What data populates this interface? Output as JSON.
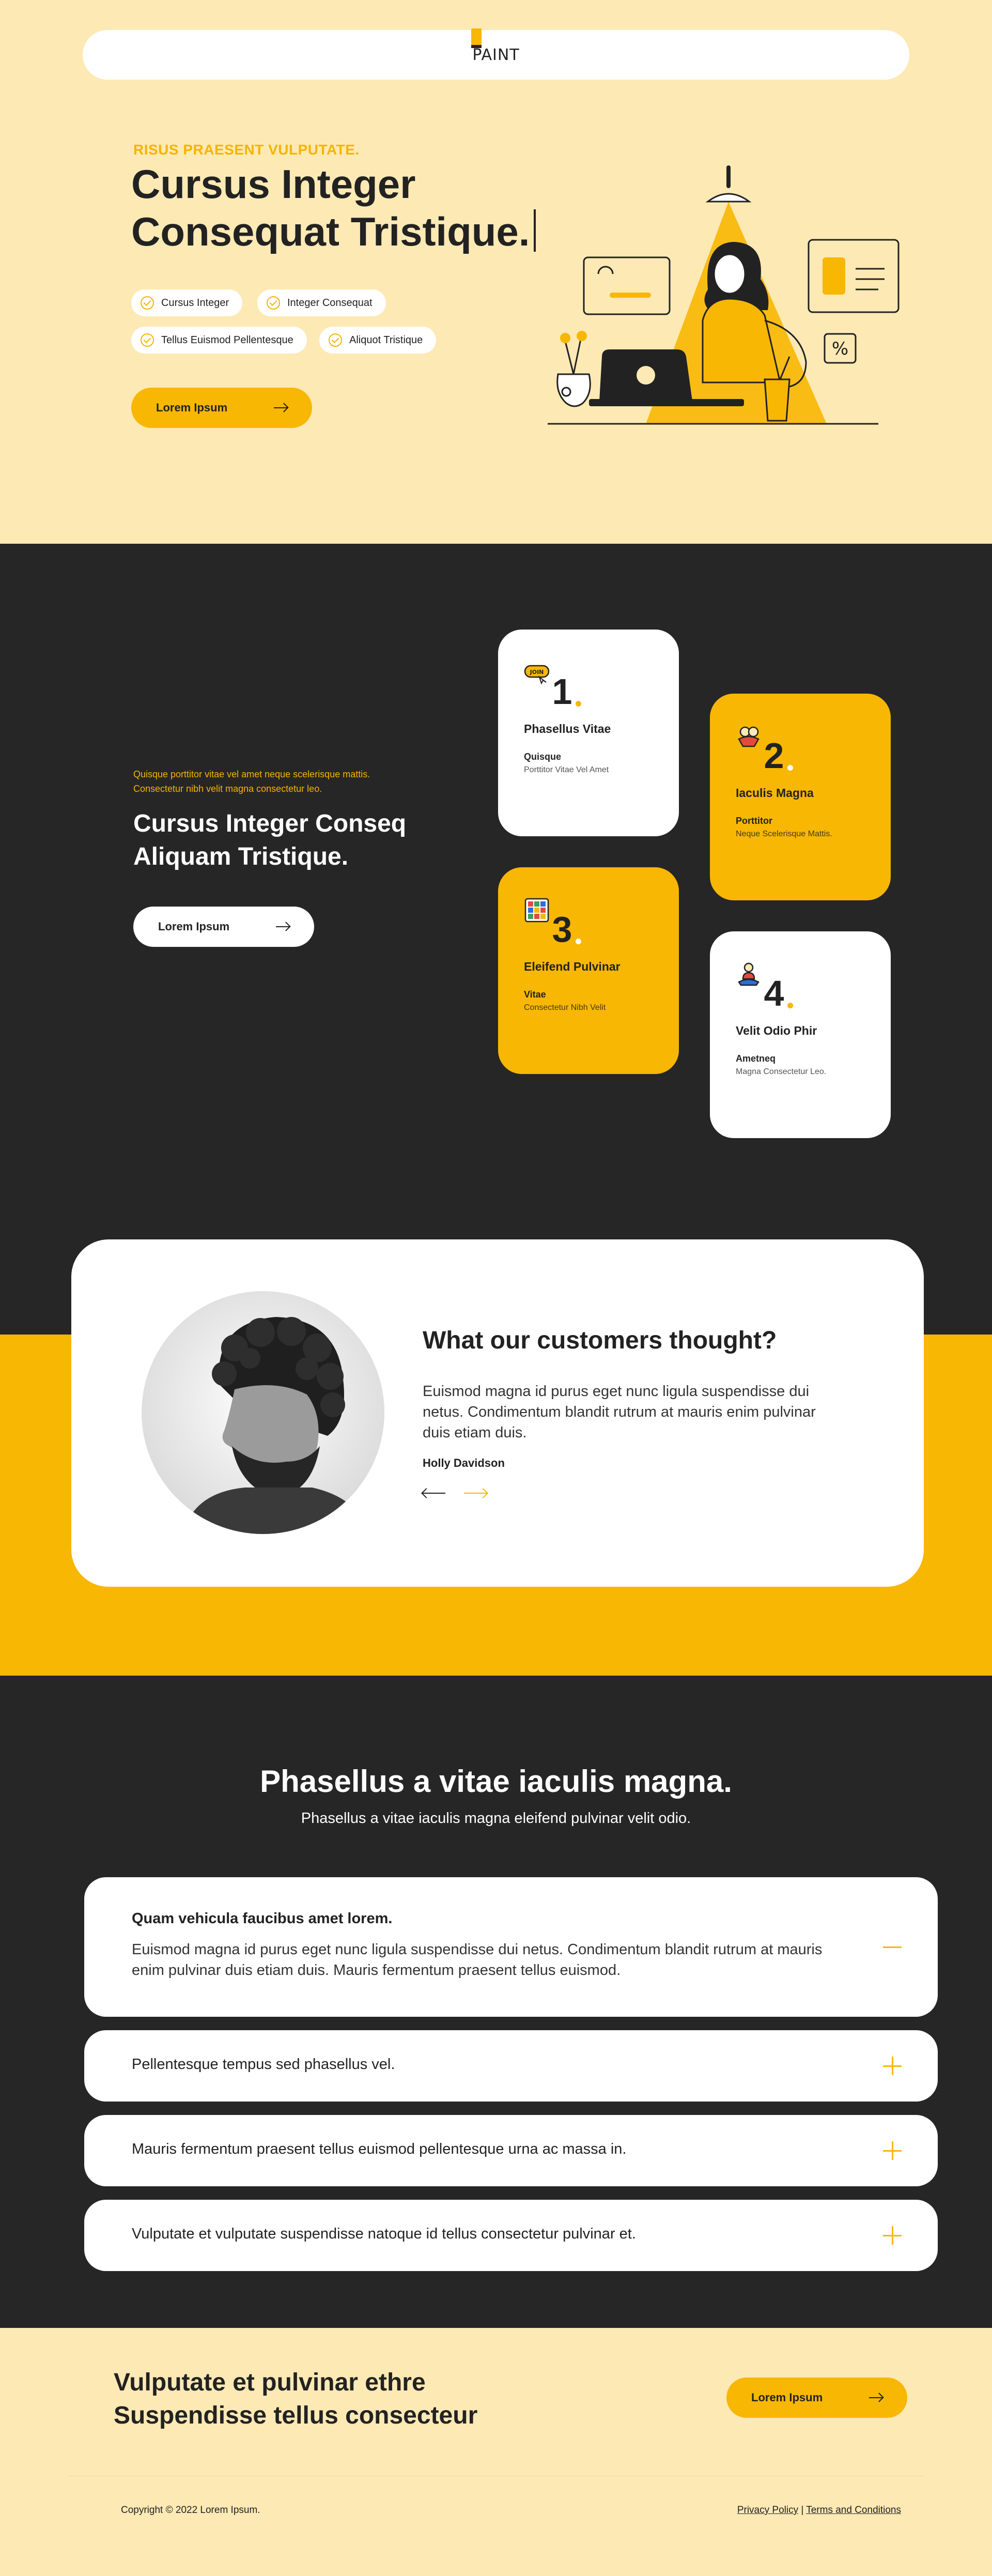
{
  "nav": {
    "logo": "PAINT"
  },
  "hero": {
    "eyebrow": "RISUS PRAESENT VULPUTATE.",
    "title_line1": "Cursus Integer",
    "title_line2": "Consequat Tristique.",
    "pills": [
      "Cursus Integer",
      "Integer Consequat",
      "Tellus Euismod Pellentesque",
      "Aliquot Tristique"
    ],
    "button": "Lorem Ipsum"
  },
  "features": {
    "eyebrow": "Quisque porttitor vitae vel amet neque scelerisque mattis. Consectetur nibh velit magna consectetur leo.",
    "title": "Cursus Integer Conseq Aliquam Tristique.",
    "button": "Lorem Ipsum",
    "cards": [
      {
        "num": "1",
        "title": "Phasellus Vitae",
        "sub": "Quisque",
        "desc": "Porttitor Vitae Vel Amet",
        "icon": "join-badge-icon",
        "badge": "JOIN"
      },
      {
        "num": "2",
        "title": "Iaculis Magna",
        "sub": "Porttitor",
        "desc": "Neque Scelerisque Mattis.",
        "icon": "handshake-icon"
      },
      {
        "num": "3",
        "title": "Eleifend Pulvinar",
        "sub": "Vitae",
        "desc": "Consectetur Nibh Velit",
        "icon": "color-grid-icon"
      },
      {
        "num": "4",
        "title": "Velit Odio Phir",
        "sub": "Ametneq",
        "desc": "Magna Consectetur Leo.",
        "icon": "meditation-icon"
      }
    ]
  },
  "testimonial": {
    "heading": "What our customers thought?",
    "quote": "Euismod magna id purus eget nunc ligula suspendisse dui netus. Condimentum blandit rutrum at mauris enim pulvinar duis etiam duis.",
    "author": "Holly Davidson"
  },
  "faq": {
    "title": "Phasellus a vitae iaculis magna.",
    "subtitle": "Phasellus a vitae iaculis magna eleifend pulvinar velit odio.",
    "items": [
      {
        "question": "Quam vehicula faucibus amet lorem.",
        "answer": "Euismod magna id purus eget nunc ligula suspendisse dui netus. Condimentum blandit rutrum at mauris enim pulvinar duis etiam duis. Mauris fermentum praesent tellus euismod.",
        "open": true
      },
      {
        "question": "Pellentesque tempus sed phasellus vel.",
        "open": false
      },
      {
        "question": "Mauris fermentum praesent tellus euismod pellentesque urna ac massa in.",
        "open": false
      },
      {
        "question": "Vulputate et vulputate suspendisse natoque id tellus consectetur pulvinar et.",
        "open": false
      }
    ]
  },
  "cta": {
    "title": "Vulputate et pulvinar ethre Suspendisse tellus consecteur",
    "button": "Lorem Ipsum"
  },
  "footer": {
    "copyright": "Copyright © 2022 Lorem Ipsum.",
    "privacy": "Privacy Policy",
    "separator": "|",
    "terms": "Terms and Conditions"
  },
  "colors": {
    "accent": "#f8b703",
    "dark": "#262626",
    "cream": "#fde9b4"
  }
}
